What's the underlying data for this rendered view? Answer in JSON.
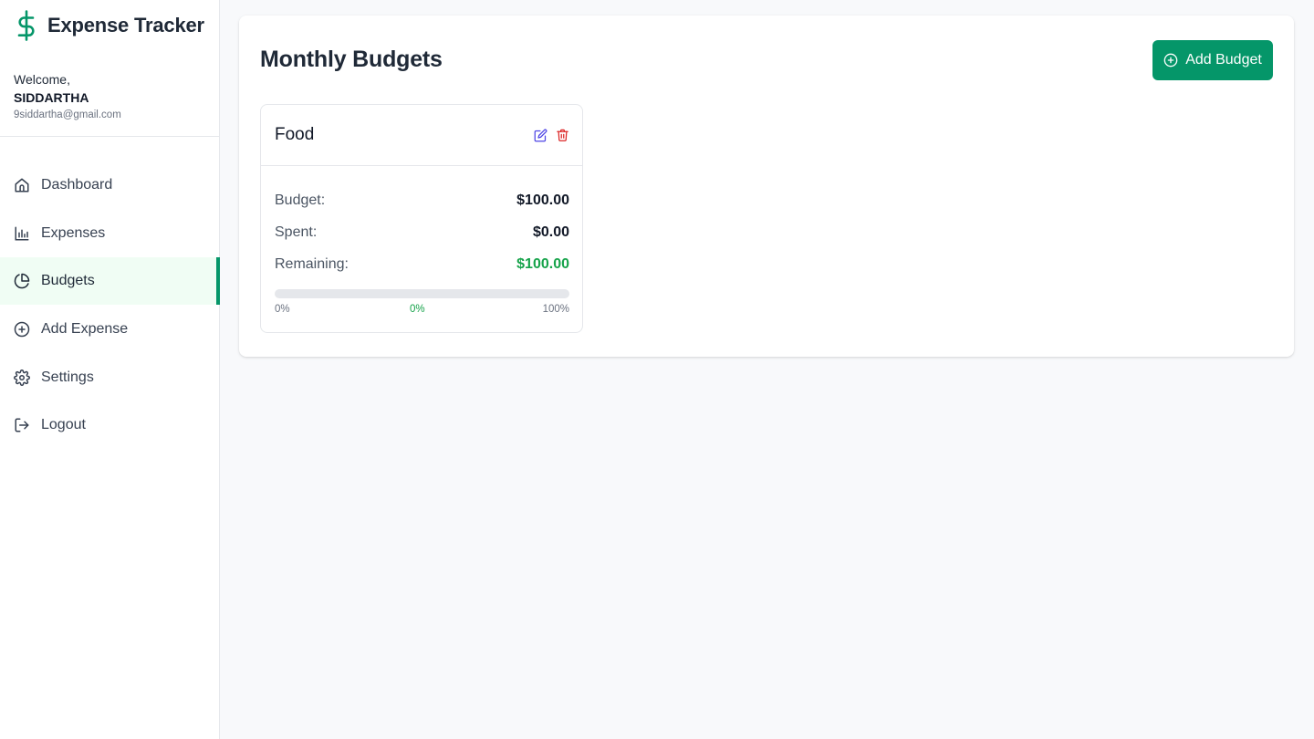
{
  "app": {
    "title": "Expense Tracker",
    "brand_color": "#059669",
    "brand_icon": "dollar-sign-icon"
  },
  "user": {
    "welcome": "Welcome,",
    "name": "SIDDARTHA",
    "email": "9siddartha@gmail.com"
  },
  "sidebar": {
    "items": [
      {
        "label": "Dashboard",
        "icon": "home-icon",
        "active": false
      },
      {
        "label": "Expenses",
        "icon": "bar-chart-icon",
        "active": false
      },
      {
        "label": "Budgets",
        "icon": "pie-chart-icon",
        "active": true
      },
      {
        "label": "Add Expense",
        "icon": "plus-circle-icon",
        "active": false
      },
      {
        "label": "Settings",
        "icon": "gear-icon",
        "active": false
      },
      {
        "label": "Logout",
        "icon": "logout-icon",
        "active": false
      }
    ]
  },
  "main": {
    "title": "Monthly Budgets",
    "add_button_label": "Add Budget",
    "add_button_icon": "plus-circle-icon"
  },
  "budgets": [
    {
      "category": "Food",
      "budget_label": "Budget:",
      "budget_value": "$100.00",
      "spent_label": "Spent:",
      "spent_value": "$0.00",
      "remaining_label": "Remaining:",
      "remaining_value": "$100.00",
      "progress_percent": 0,
      "progress_min_label": "0%",
      "progress_current_label": "0%",
      "progress_max_label": "100%",
      "edit_icon_color": "#4f46e5",
      "delete_icon_color": "#dc2626",
      "remaining_color": "#16a34a"
    }
  ]
}
